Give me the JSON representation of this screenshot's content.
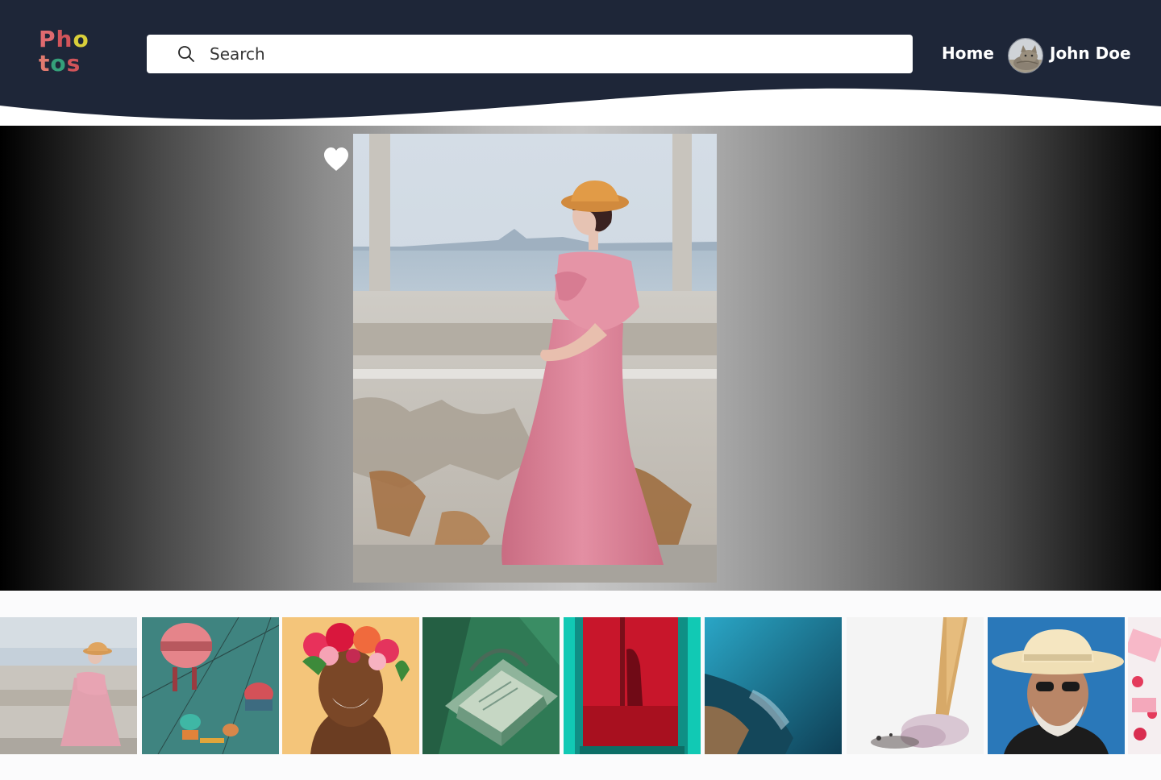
{
  "app": {
    "logo_line1": [
      "P",
      "h",
      "o"
    ],
    "logo_line2": [
      "t",
      "o",
      "s"
    ],
    "logo_colors": {
      "P": "#e06a6f",
      "h": "#d1545a",
      "o1": "#d9cf3a",
      "t": "#e07a6f",
      "o2": "#35a07a",
      "s": "#d1545a"
    },
    "header_bg": "#1e2638"
  },
  "search": {
    "placeholder": "Search",
    "value": ""
  },
  "nav": {
    "home_label": "Home"
  },
  "user": {
    "name": "John Doe",
    "avatar_icon": "cat-avatar"
  },
  "hero": {
    "photo_subject": "woman-in-pink-dress",
    "favorite_icon": "heart-icon"
  },
  "thumbnails": [
    {
      "name": "woman-in-pink-dress"
    },
    {
      "name": "cable-cars"
    },
    {
      "name": "woman-flower-crown"
    },
    {
      "name": "green-radio"
    },
    {
      "name": "red-door-window"
    },
    {
      "name": "ocean-shore"
    },
    {
      "name": "ice-cream-cone"
    },
    {
      "name": "man-in-hat"
    },
    {
      "name": "pink-dessert"
    }
  ]
}
